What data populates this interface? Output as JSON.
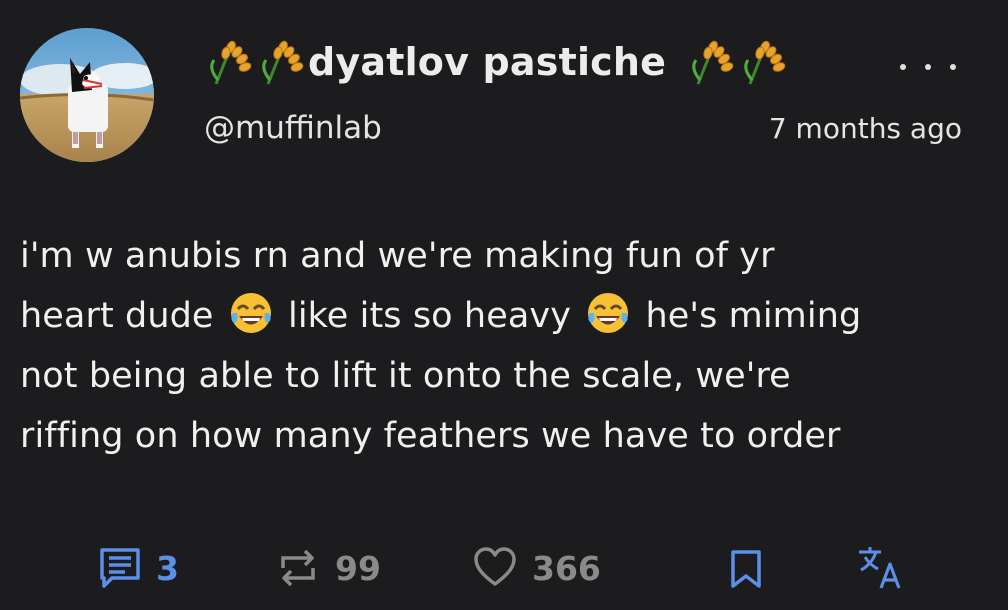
{
  "post": {
    "author": {
      "display_name": "dyatlov pastiche",
      "name_emoji": "ear-of-rice",
      "handle": "@muffinlab",
      "avatar": "avatar"
    },
    "timestamp": "7 months ago",
    "menu_icon": "more-horizontal-icon",
    "body_lines": [
      "i'm w anubis rn and we're making fun of yr",
      "heart dude",
      "like its so heavy",
      "he's miming",
      "not being able to lift it onto the scale, we're",
      "riffing on how many feathers we have to order"
    ],
    "body_emoji": "face-with-tears-of-joy",
    "actions": {
      "comments": {
        "icon": "comment-icon",
        "count": "3",
        "color": "#5b8fe8"
      },
      "reposts": {
        "icon": "repost-icon",
        "count": "99",
        "color": "#8a8a8a"
      },
      "likes": {
        "icon": "heart-icon",
        "count": "366",
        "color": "#8a8a8a"
      },
      "bookmark": {
        "icon": "bookmark-icon",
        "color": "#5b8fe8"
      },
      "translate": {
        "icon": "translate-icon",
        "color": "#5b8fe8"
      }
    }
  }
}
